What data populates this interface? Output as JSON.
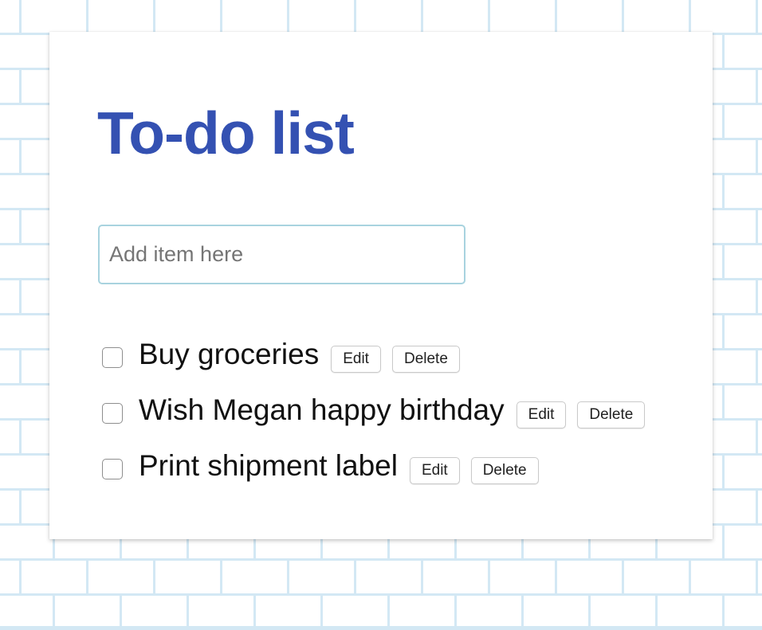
{
  "page": {
    "title": "To-do list"
  },
  "new_item": {
    "value": "",
    "placeholder": "Add item here"
  },
  "todos": [
    {
      "label": "Buy groceries",
      "checked": false,
      "edit_label": "Edit",
      "delete_label": "Delete"
    },
    {
      "label": "Wish Megan happy birthday",
      "checked": false,
      "edit_label": "Edit",
      "delete_label": "Delete"
    },
    {
      "label": "Print shipment label",
      "checked": false,
      "edit_label": "Edit",
      "delete_label": "Delete"
    }
  ],
  "colors": {
    "title": "#3451b2",
    "input_border": "#a8d3df",
    "brick_lines": "#d3e8f4",
    "card_background": "#ffffff"
  }
}
